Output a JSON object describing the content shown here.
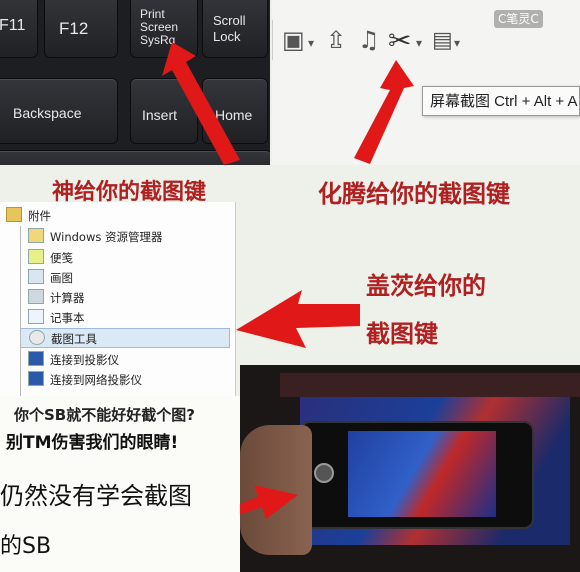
{
  "keyboard": {
    "keys": {
      "f11": "F11",
      "f12": "F12",
      "print_screen": [
        "Print",
        "Screen",
        "SysRq"
      ],
      "scroll_lock": [
        "Scroll",
        "Lock"
      ],
      "backspace": "Backspace",
      "insert": "Insert",
      "home": "Home"
    }
  },
  "toolbar": {
    "icons": [
      "picture-icon",
      "upload-icon",
      "music-icon",
      "scissors-icon",
      "comment-icon"
    ],
    "tooltip": "屏幕截图 Ctrl + Alt + A"
  },
  "watermark": "C笔灵C",
  "captions": {
    "god": "神给你的截图键",
    "huateng": "化腾给你的截图键",
    "gates_line1": "盖茨给你的",
    "gates_line2": "截图键"
  },
  "menu": {
    "header": "附件",
    "items": [
      "Windows 资源管理器",
      "便笺",
      "画图",
      "计算器",
      "记事本",
      "截图工具",
      "连接到投影仪",
      "连接到网络投影仪"
    ],
    "selected_index": 5
  },
  "bottom_text": {
    "line1": "你个SB就不能好好截个图?",
    "line2": "别TM伤害我们的眼睛!",
    "line3": "仍然没有学会截图",
    "line4": "的SB"
  },
  "colors": {
    "arrow_red": "#e01818",
    "caption_red": "#b02020",
    "keyboard_dark": "#1d1e22"
  }
}
